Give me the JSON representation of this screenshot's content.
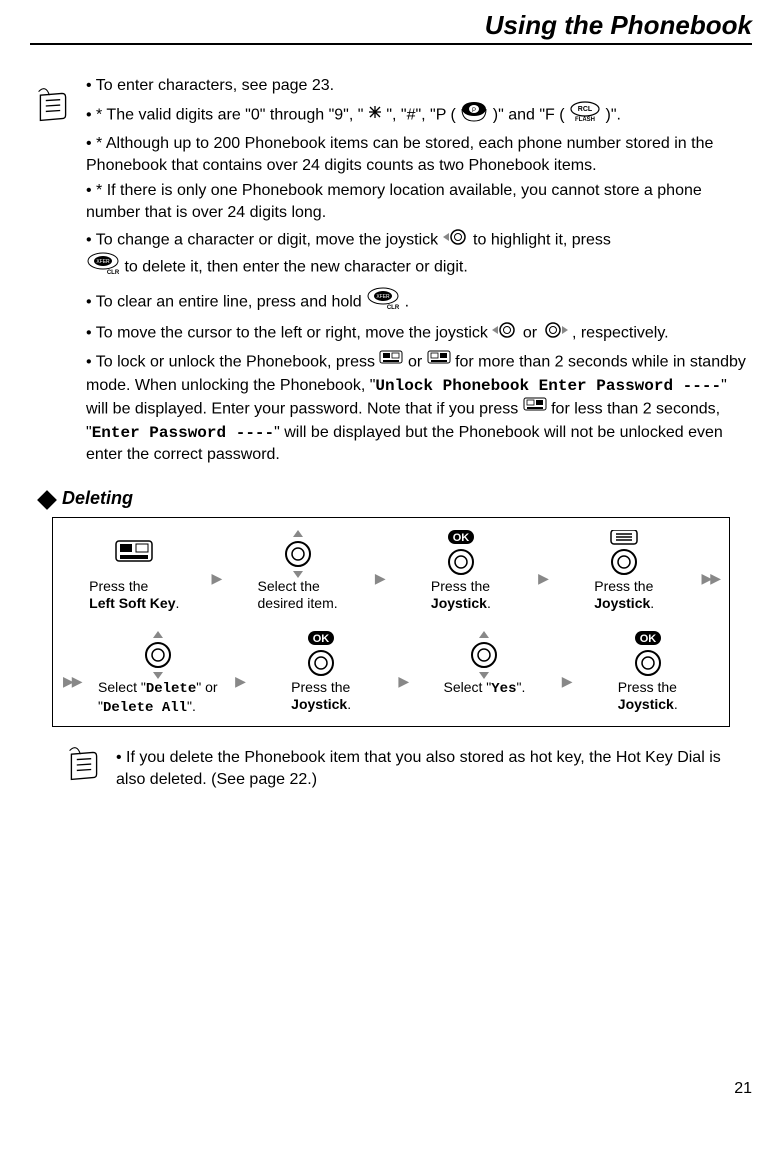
{
  "header": {
    "title": "Using the Phonebook"
  },
  "bullets": {
    "b1": "• To enter characters, see page 23.",
    "b2_a": "• * The valid digits are \"0\" through \"9\", \" ",
    "b2_b": " \", \"#\", \"P (",
    "b2_c": ")\" and \"F (",
    "b2_d": ")\".",
    "b3": "• * Although up to 200 Phonebook items can be stored, each phone number stored in the Phonebook that contains over 24 digits counts as two Phonebook items.",
    "b4": "• * If there is only one Phonebook memory location available, you cannot store a phone number that is over 24 digits long.",
    "b5_a": "• To change a character or digit, move the joystick ",
    "b5_b": " to highlight it, press ",
    "b5_c": " to delete it, then enter the new character or digit.",
    "b6_a": "• To clear an entire line, press and hold ",
    "b6_b": ".",
    "b7_a": "• To move the cursor to the left or right, move the joystick ",
    "b7_b": " or ",
    "b7_c": " , respectively.",
    "b8_a": "• To lock or unlock the Phonebook, press ",
    "b8_b": " or ",
    "b8_c": " for more than 2 seconds while in standby mode. When unlocking the Phonebook, \"",
    "b8_d": "Unlock Phonebook Enter Password ----",
    "b8_e": "\" will be displayed. Enter your password. Note that if you press ",
    "b8_f": " for less than 2 seconds, \"",
    "b8_g": "Enter Password ----",
    "b8_h": "\" will be displayed but the Phonebook will not be unlocked even enter the correct password."
  },
  "section": {
    "title": "Deleting"
  },
  "steps": {
    "s1": {
      "line1": "Press the",
      "line2": "Left Soft Key",
      "punct": "."
    },
    "s2": {
      "line1": "Select the",
      "line2": "desired item."
    },
    "s3": {
      "line1": "Press the",
      "line2": "Joystick",
      "punct": "."
    },
    "s4": {
      "line1": "Press the",
      "line2": "Joystick",
      "punct": "."
    },
    "s5": {
      "line1_a": "Select \"",
      "line1_b": "Delete",
      "line1_c": "\" or",
      "line2_a": "\"",
      "line2_b": "Delete All",
      "line2_c": "\"."
    },
    "s6": {
      "line1": "Press the",
      "line2": "Joystick",
      "punct": "."
    },
    "s7": {
      "line1_a": "Select \"",
      "line1_b": "Yes",
      "line1_c": "\"."
    },
    "s8": {
      "line1": "Press the",
      "line2": "Joystick",
      "punct": "."
    }
  },
  "final_note": "• If you delete the Phonebook item that you also stored as hot key, the Hot Key Dial is also deleted. (See page 22.)",
  "page_number": "21",
  "keycaps": {
    "rcl": "RCL",
    "flash_label": "FLASH",
    "xfer": "XFER",
    "clr": "CLR",
    "p": "P",
    "ok": "OK"
  }
}
